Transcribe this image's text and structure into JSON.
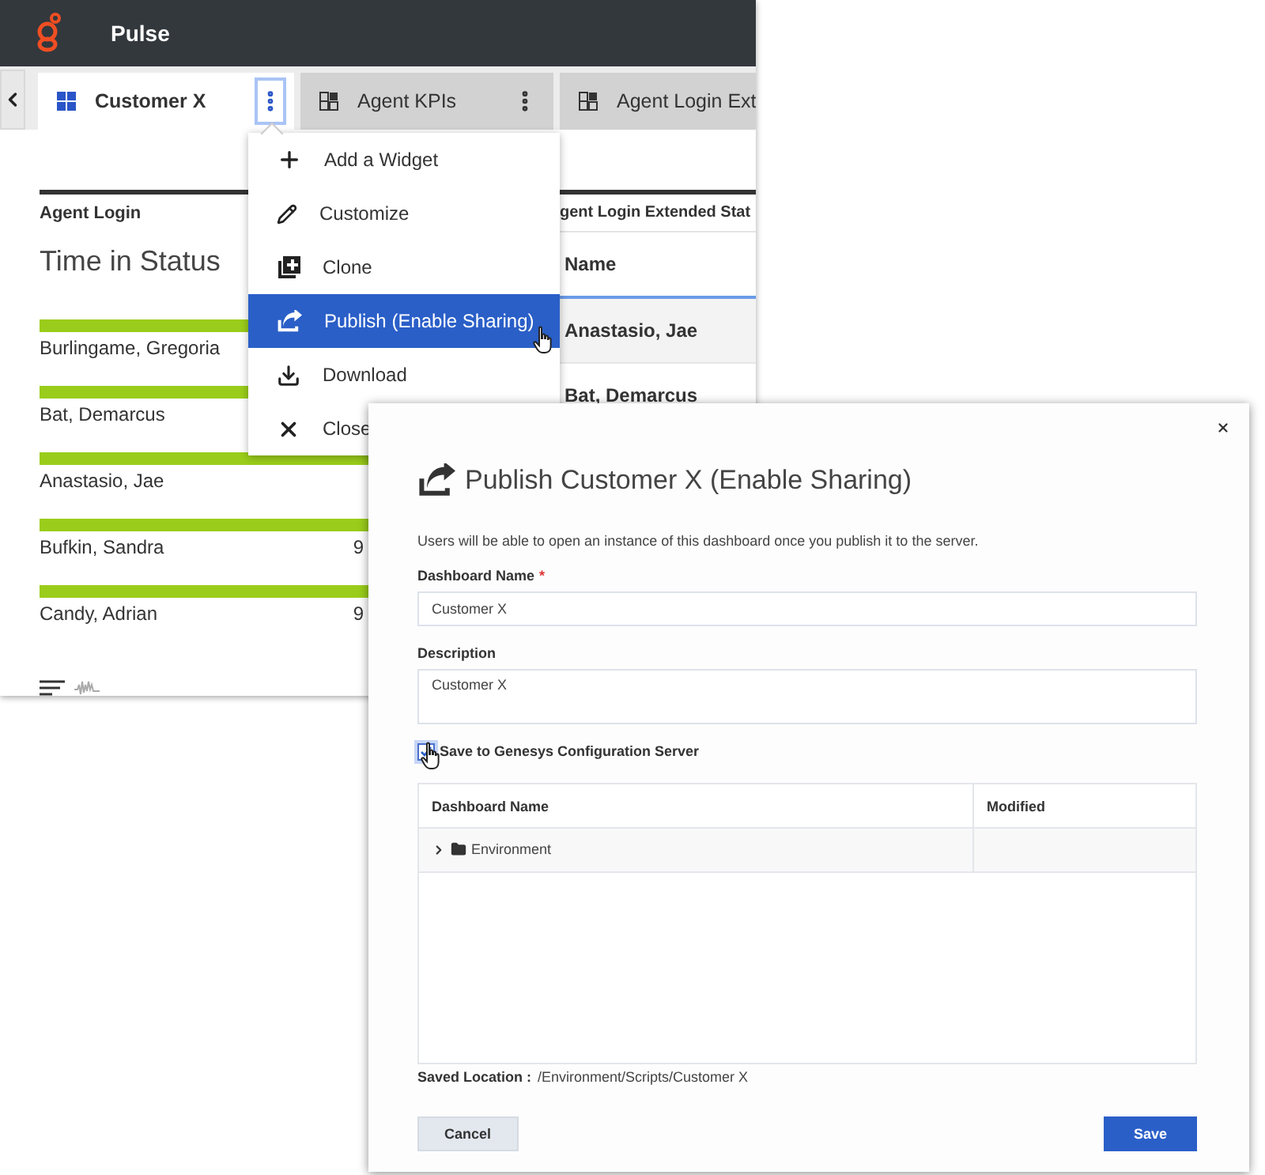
{
  "app": {
    "name": "Pulse"
  },
  "tabs": [
    {
      "label": "Customer X",
      "selected": true,
      "menu_button": true
    },
    {
      "label": "Agent KPIs",
      "selected": false,
      "menu_button": true
    },
    {
      "label": "Agent Login Ext",
      "selected": false,
      "menu_button": false
    }
  ],
  "widgets": [
    {
      "title": "Agent Login",
      "heading": "Time in Status",
      "rows": [
        {
          "name": "Burlingame, Gregoria"
        },
        {
          "name": "Bat, Demarcus"
        },
        {
          "name": "Anastasio, Jae"
        },
        {
          "name": "Bufkin, Sandra",
          "value": "9"
        },
        {
          "name": "Candy, Adrian",
          "value": "9"
        }
      ]
    },
    {
      "title": "gent Login Extended Stat",
      "column": "Name",
      "rows": [
        "Anastasio, Jae",
        "Bat, Demarcus"
      ]
    }
  ],
  "menu": [
    {
      "kind": "add",
      "label": "Add a Widget",
      "selected": false
    },
    {
      "kind": "edit",
      "label": "Customize",
      "selected": false
    },
    {
      "kind": "clone",
      "label": "Clone",
      "selected": false
    },
    {
      "kind": "publish",
      "label": "Publish (Enable Sharing)",
      "selected": true
    },
    {
      "kind": "download",
      "label": "Download",
      "selected": false
    },
    {
      "kind": "close",
      "label": "Close",
      "selected": false
    }
  ],
  "dialog": {
    "title": "Publish Customer X (Enable Sharing)",
    "intro": "Users will be able to open an instance of this dashboard once you publish it to the server.",
    "name_field": {
      "label": "Dashboard Name",
      "required_mark": "*",
      "value": "Customer X"
    },
    "description_field": {
      "label": "Description",
      "value": "Customer X"
    },
    "save_option": {
      "label": "Save to Genesys Configuration Server",
      "checked": true
    },
    "table": {
      "columns": [
        "Dashboard Name",
        "Modified"
      ],
      "rows": [
        {
          "name": "Environment",
          "expanded": false
        }
      ]
    },
    "saved_location": {
      "label": "Saved Location :",
      "value": "/Environment/Scripts/Customer X"
    },
    "buttons": {
      "cancel": "Cancel",
      "save": "Save"
    }
  }
}
